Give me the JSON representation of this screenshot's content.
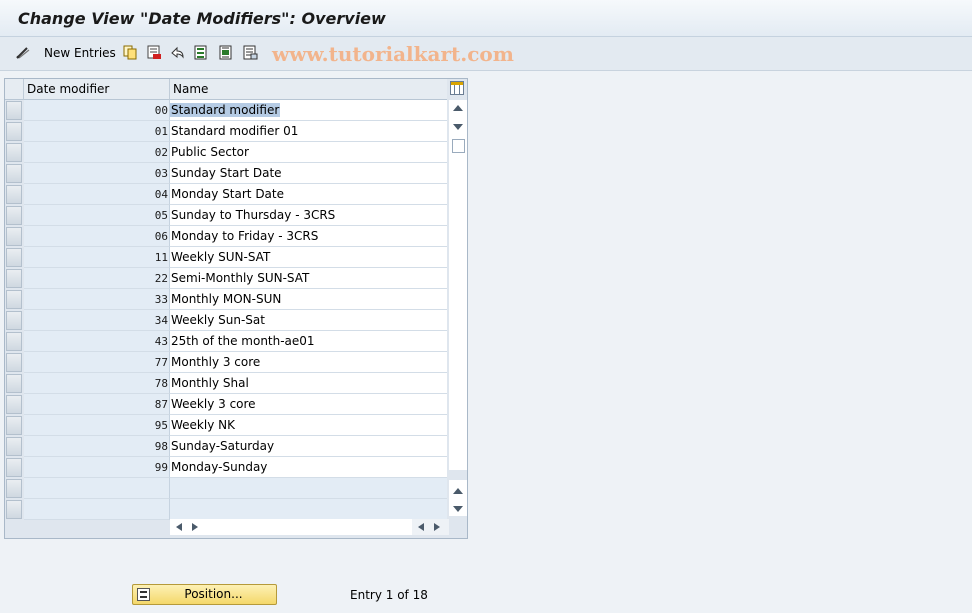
{
  "window": {
    "title": "Change View \"Date Modifiers\": Overview"
  },
  "toolbar": {
    "new_entries_label": "New Entries",
    "icons": [
      "edit-glasses-icon",
      "copy-icon",
      "delete-icon",
      "undo-icon",
      "select-all-icon",
      "select-block-icon",
      "deselect-all-icon"
    ],
    "watermark": "www.tutorialkart.com"
  },
  "table": {
    "columns": [
      "Date modifier",
      "Name"
    ],
    "rows": [
      {
        "code": "00",
        "name": "Standard modifier",
        "selected": true
      },
      {
        "code": "01",
        "name": "Standard modifier 01"
      },
      {
        "code": "02",
        "name": "Public Sector"
      },
      {
        "code": "03",
        "name": "Sunday Start Date"
      },
      {
        "code": "04",
        "name": "Monday Start Date"
      },
      {
        "code": "05",
        "name": "Sunday to Thursday - 3CRS"
      },
      {
        "code": "06",
        "name": "Monday to Friday - 3CRS"
      },
      {
        "code": "11",
        "name": "Weekly SUN-SAT"
      },
      {
        "code": "22",
        "name": "Semi-Monthly SUN-SAT"
      },
      {
        "code": "33",
        "name": "Monthly MON-SUN"
      },
      {
        "code": "34",
        "name": "Weekly Sun-Sat"
      },
      {
        "code": "43",
        "name": "25th of the month-ae01"
      },
      {
        "code": "77",
        "name": "Monthly 3 core"
      },
      {
        "code": "78",
        "name": "Monthly Shal"
      },
      {
        "code": "87",
        "name": "Weekly 3 core"
      },
      {
        "code": "95",
        "name": "Weekly NK"
      },
      {
        "code": "98",
        "name": "Sunday-Saturday"
      },
      {
        "code": "99",
        "name": "Monday-Sunday"
      }
    ],
    "empty_rows": 2
  },
  "footer": {
    "position_button_label": "Position...",
    "entry_info": "Entry 1 of 18"
  },
  "colors": {
    "title_bg": "#e3ebf3",
    "selection": "#b5cbe4",
    "position_button": "#f4d86a",
    "watermark": "#f2b48c"
  }
}
